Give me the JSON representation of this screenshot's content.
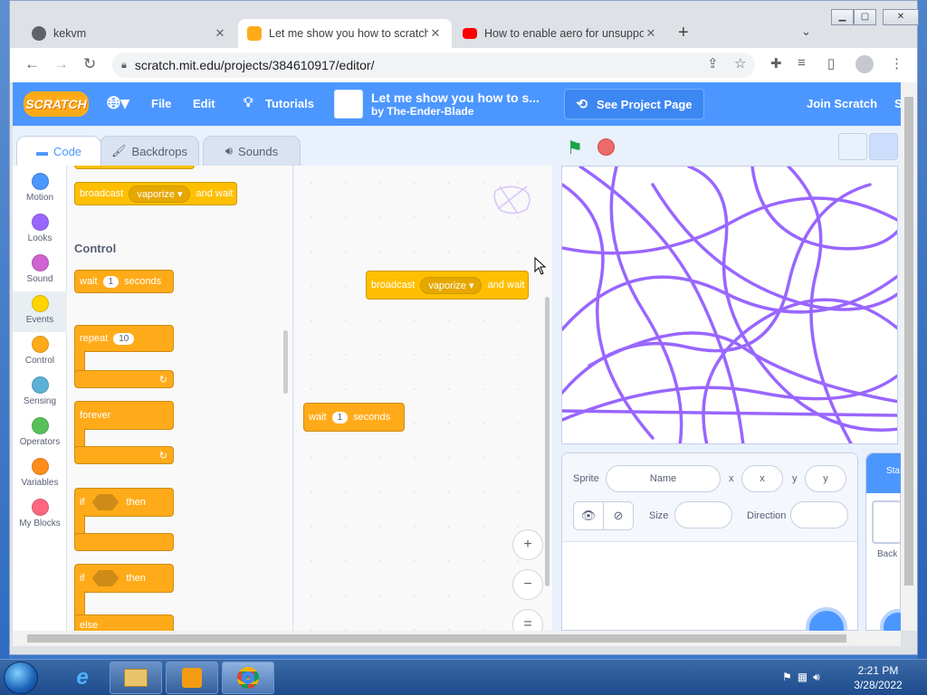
{
  "browser": {
    "tabs": [
      {
        "title": "kekvm",
        "favicon": "globe-icon",
        "favicon_color": "#5f6368"
      },
      {
        "title": "Let me show you how to scratch",
        "favicon": "scratch-icon",
        "favicon_color": "#ffab19",
        "active": true
      },
      {
        "title": "How to enable aero for unsuppo",
        "favicon": "youtube-icon",
        "favicon_color": "#ff0000"
      }
    ],
    "close_glyph": "✕",
    "new_tab_glyph": "+",
    "url": "scratch.mit.edu/projects/384610917/editor/",
    "window_controls": {
      "minimize": "▁",
      "maximize": "▢",
      "close": "✕"
    }
  },
  "scratch": {
    "logo": "SCRATCH",
    "menu": {
      "file": "File",
      "edit": "Edit",
      "tutorials": "Tutorials",
      "join": "Join Scratch",
      "cut_char": "S"
    },
    "project": {
      "title": "Let me show you how to s...",
      "by_prefix": "by",
      "author": "The-Ender-Blade"
    },
    "see_project_page": "See Project Page",
    "editor_tabs": {
      "code": "Code",
      "backdrops": "Backdrops",
      "sounds": "Sounds"
    },
    "categories": [
      {
        "label": "Motion",
        "color": "#4c97ff"
      },
      {
        "label": "Looks",
        "color": "#9966ff"
      },
      {
        "label": "Sound",
        "color": "#cf63cf"
      },
      {
        "label": "Events",
        "color": "#ffd500",
        "selected": true
      },
      {
        "label": "Control",
        "color": "#ffab19"
      },
      {
        "label": "Sensing",
        "color": "#5cb1d6"
      },
      {
        "label": "Operators",
        "color": "#59c059"
      },
      {
        "label": "Variables",
        "color": "#ff8c1a"
      },
      {
        "label": "My Blocks",
        "color": "#ff6680"
      }
    ],
    "palette": {
      "broadcast": {
        "text": "broadcast",
        "message": "vaporize",
        "suffix": "and wait"
      },
      "control_heading": "Control",
      "wait": {
        "text": "wait",
        "value": "1",
        "suffix": "seconds"
      },
      "repeat": {
        "text": "repeat",
        "value": "10"
      },
      "forever": "forever",
      "if": {
        "text": "if",
        "then": "then"
      },
      "if_else": {
        "text": "if",
        "then": "then",
        "else": "else"
      }
    },
    "script": {
      "broadcast": {
        "text": "broadcast",
        "message": "vaporize",
        "suffix": "and wait"
      },
      "wait": {
        "text": "wait",
        "value": "1",
        "suffix": "seconds"
      }
    },
    "zoom": {
      "in": "+",
      "out": "−",
      "reset": "="
    },
    "sprite_info": {
      "sprite_label": "Sprite",
      "name_placeholder": "Name",
      "x_label": "x",
      "x_placeholder": "x",
      "y_label": "y",
      "y_placeholder": "y",
      "size_label": "Size",
      "direction_label": "Direction"
    },
    "stage_panel": {
      "header": "Sta",
      "backdrop_label": "Back"
    }
  },
  "taskbar": {
    "time": "2:21 PM",
    "date": "3/28/2022"
  },
  "colors": {
    "scratch_blue": "#4c97ff",
    "events": "#ffbf00",
    "control": "#ffab19",
    "pen": "#9966ff"
  }
}
